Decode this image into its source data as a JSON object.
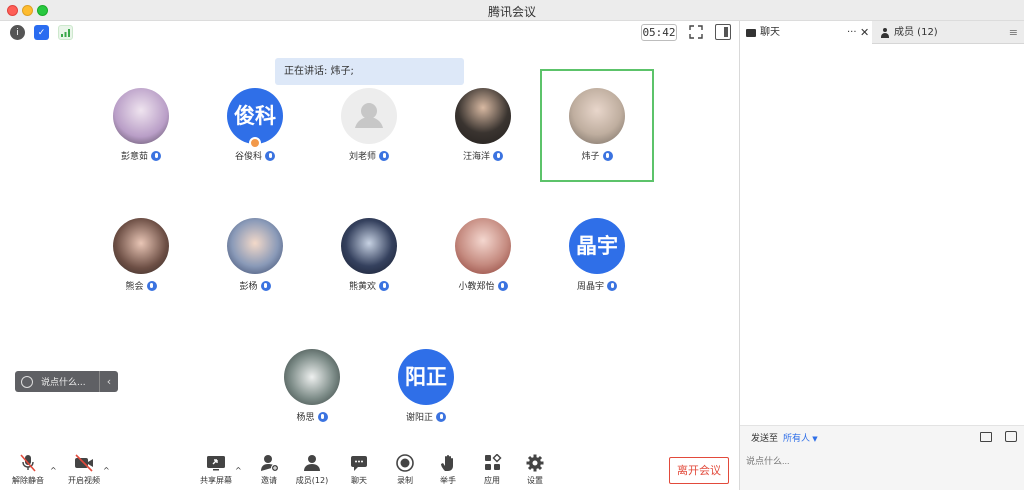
{
  "window": {
    "title": "腾讯会议"
  },
  "topbar": {
    "timer": "05:42"
  },
  "speaking": {
    "text": "正在讲话: 炜子;"
  },
  "participants": [
    {
      "name": "彭意茹",
      "avatar": "photo"
    },
    {
      "name": "谷俊科",
      "avatar": "text",
      "initials": "俊科",
      "host": true
    },
    {
      "name": "刘老师",
      "avatar": "default"
    },
    {
      "name": "汪海洋",
      "avatar": "photo"
    },
    {
      "name": "炜子",
      "avatar": "photo",
      "speaking": true
    },
    {
      "name": "熊会",
      "avatar": "photo"
    },
    {
      "name": "彭杨",
      "avatar": "photo"
    },
    {
      "name": "熊黄欢",
      "avatar": "photo"
    },
    {
      "name": "小教郑怡",
      "avatar": "photo"
    },
    {
      "name": "周晶宇",
      "avatar": "text",
      "initials": "晶宇"
    },
    {
      "name": "杨思",
      "avatar": "photo"
    },
    {
      "name": "谢阳正",
      "avatar": "text",
      "initials": "阳正"
    }
  ],
  "quick_chat": {
    "placeholder": "说点什么..."
  },
  "toolbar": {
    "unmute": "解除静音",
    "start_video": "开启视频",
    "share_screen": "共享屏幕",
    "invite": "邀请",
    "members": "成员(12)",
    "chat": "聊天",
    "record": "录制",
    "raise_hand": "举手",
    "apps": "应用",
    "settings": "设置",
    "leave": "离开会议"
  },
  "panel": {
    "tab_chat": "聊天",
    "tab_members": "成员 (12)",
    "send_to_label": "发送至",
    "send_to_target": "所有人",
    "input_placeholder": "说点什么..."
  },
  "colors": {
    "accent": "#2f6fe8",
    "danger": "#e24a3b",
    "speaker_frame": "#5cc36a"
  }
}
